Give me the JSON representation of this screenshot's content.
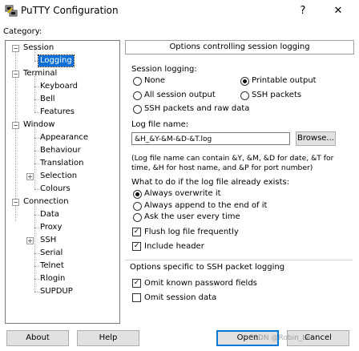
{
  "window": {
    "title": "PuTTY Configuration",
    "help_glyph": "?",
    "close_glyph": "✕"
  },
  "category_label": "Category:",
  "tree": [
    {
      "label": "Session"
    },
    {
      "label": "Logging"
    },
    {
      "label": "Terminal"
    },
    {
      "label": "Keyboard"
    },
    {
      "label": "Bell"
    },
    {
      "label": "Features"
    },
    {
      "label": "Window"
    },
    {
      "label": "Appearance"
    },
    {
      "label": "Behaviour"
    },
    {
      "label": "Translation"
    },
    {
      "label": "Selection"
    },
    {
      "label": "Colours"
    },
    {
      "label": "Connection"
    },
    {
      "label": "Data"
    },
    {
      "label": "Proxy"
    },
    {
      "label": "SSH"
    },
    {
      "label": "Serial"
    },
    {
      "label": "Telnet"
    },
    {
      "label": "Rlogin"
    },
    {
      "label": "SUPDUP"
    }
  ],
  "panel": {
    "header": "Options controlling session logging",
    "session_logging_label": "Session logging:",
    "opt_none": "None",
    "opt_printable": "Printable output",
    "opt_all": "All session output",
    "opt_ssh_packets": "SSH packets",
    "opt_ssh_raw": "SSH packets and raw data",
    "selected_mode": "Printable output",
    "log_file_label": "Log file name:",
    "log_file_value": "&H_&Y-&M-&D-&T.log",
    "browse_label": "Browse...",
    "info_line1": "(Log file name can contain &Y, &M, &D for date, &T for",
    "info_line2": "time, &H for host name, and &P for port number)",
    "exists_label": "What to do if the log file already exists:",
    "exists_overwrite": "Always overwrite it",
    "exists_append": "Always append to the end of it",
    "exists_ask": "Ask the user every time",
    "selected_exists": "Always overwrite it",
    "flush_label": "Flush log file frequently",
    "flush_checked": true,
    "header_label": "Include header",
    "header_checked": true,
    "ssh_section_label": "Options specific to SSH packet logging",
    "omit_passwords_label": "Omit known password fields",
    "omit_passwords_checked": true,
    "omit_data_label": "Omit session data",
    "omit_data_checked": false
  },
  "buttons": {
    "about": "About",
    "help": "Help",
    "open": "Open",
    "cancel": "Cancel",
    "watermark": "CSDN @Robin_Lee"
  }
}
